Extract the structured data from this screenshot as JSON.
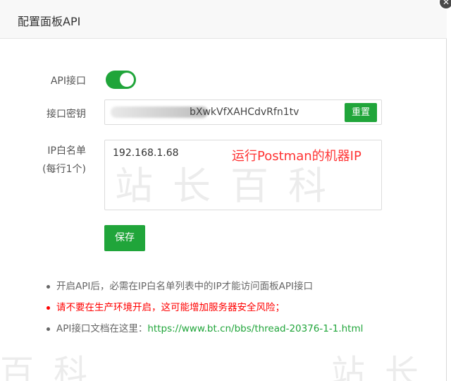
{
  "dialog": {
    "title": "配置面板API",
    "close_icon": "close-icon"
  },
  "api_toggle": {
    "label": "API接口",
    "enabled": true
  },
  "api_key": {
    "label": "接口密钥",
    "visible_value": "bXwkVfXAHCdvRfn1tv",
    "reset_label": "重置"
  },
  "ip_whitelist": {
    "label_line1": "IP白名单",
    "label_line2": "(每行1个)",
    "value": "192.168.1.68",
    "annotation": "运行Postman的机器IP"
  },
  "save_label": "保存",
  "notes": {
    "note1": "开启API后，必需在IP白名单列表中的IP才能访问面板API接口",
    "note2": "请不要在生产环境开启，这可能增加服务器安全风险；",
    "note3_prefix": "API接口文档在这里：",
    "note3_link": "https://www.bt.cn/bbs/thread-20376-1-1.html"
  },
  "colors": {
    "accent": "#20a53a",
    "warning": "#ff0000",
    "annotation": "#ff3333"
  }
}
